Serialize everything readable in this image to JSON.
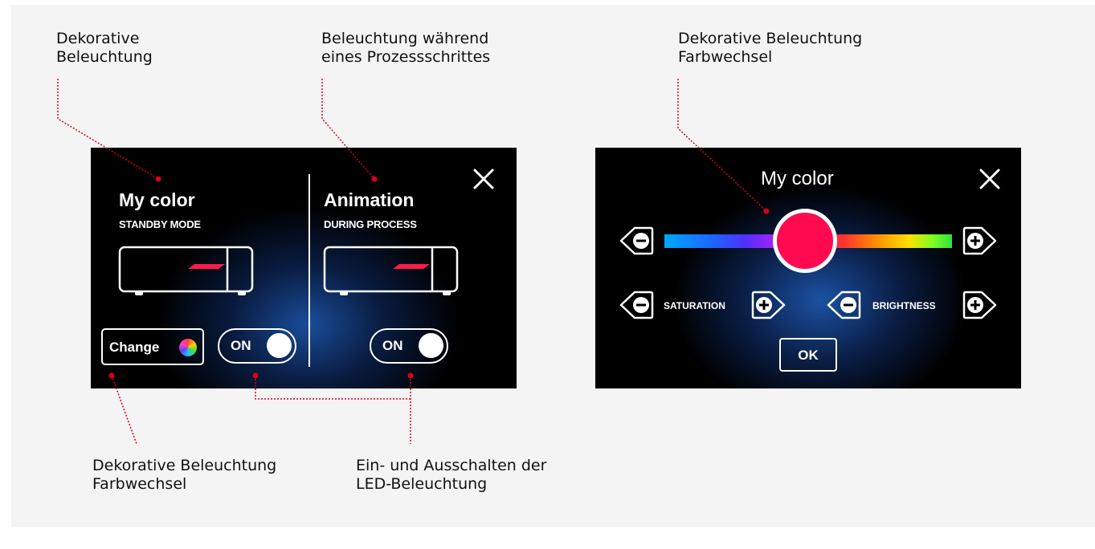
{
  "captions": {
    "top_left": [
      "Dekorative",
      "Beleuchtung"
    ],
    "top_middle": [
      "Beleuchtung während",
      "eines Prozessschrittes"
    ],
    "top_right": [
      "Dekorative Beleuchtung",
      "Farbwechsel"
    ],
    "bottom_left": [
      "Dekorative Beleuchtung",
      "Farbwechsel"
    ],
    "bottom_middle": [
      "Ein- und Ausschalten der",
      "LED-Beleuchtung"
    ]
  },
  "left_panel": {
    "my_color": {
      "title": "My color",
      "subtitle": "STANDBY MODE",
      "toggle_label": "ON"
    },
    "animation": {
      "title": "Animation",
      "subtitle": "DURING PROCESS",
      "toggle_label": "ON"
    },
    "change_label": "Change",
    "close_icon": "close-icon"
  },
  "right_panel": {
    "title": "My color",
    "saturation_label": "SATURATION",
    "brightness_label": "BRIGHTNESS",
    "ok_label": "OK",
    "selected_color": "#ff0a50",
    "close_icon": "close-icon"
  },
  "colors": {
    "annotation": "#d9001b",
    "panel_bg": "#000000",
    "glow": "#1e5ab4"
  }
}
